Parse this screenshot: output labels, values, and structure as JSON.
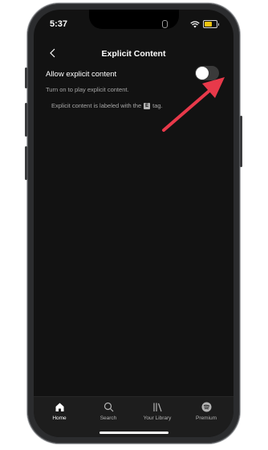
{
  "status_bar": {
    "time": "5:37"
  },
  "nav": {
    "title": "Explicit Content"
  },
  "setting": {
    "label": "Allow explicit content",
    "enabled": false,
    "description": "Turn on to play explicit content.",
    "note_before": "Explicit content is labeled with the",
    "badge": "E",
    "note_after": "tag."
  },
  "annotation": {
    "arrow_color": "#e8394a"
  },
  "tabbar": {
    "tabs": [
      {
        "label": "Home",
        "icon": "home-icon"
      },
      {
        "label": "Search",
        "icon": "search-icon"
      },
      {
        "label": "Your Library",
        "icon": "library-icon"
      },
      {
        "label": "Premium",
        "icon": "spotify-icon"
      }
    ]
  },
  "colors": {
    "background": "#121212",
    "text": "#ffffff",
    "muted": "#a7a7a7"
  }
}
